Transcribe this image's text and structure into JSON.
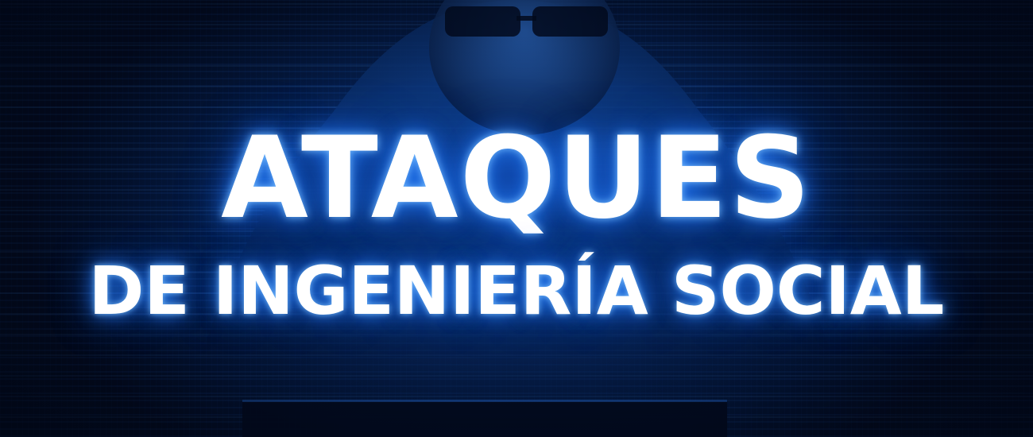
{
  "title": {
    "line1": "ATAQUES",
    "line2": "DE INGENIERÍA SOCIAL"
  },
  "colors": {
    "background": "#041b45",
    "glow": "#2882ff",
    "text": "#ffffff"
  }
}
